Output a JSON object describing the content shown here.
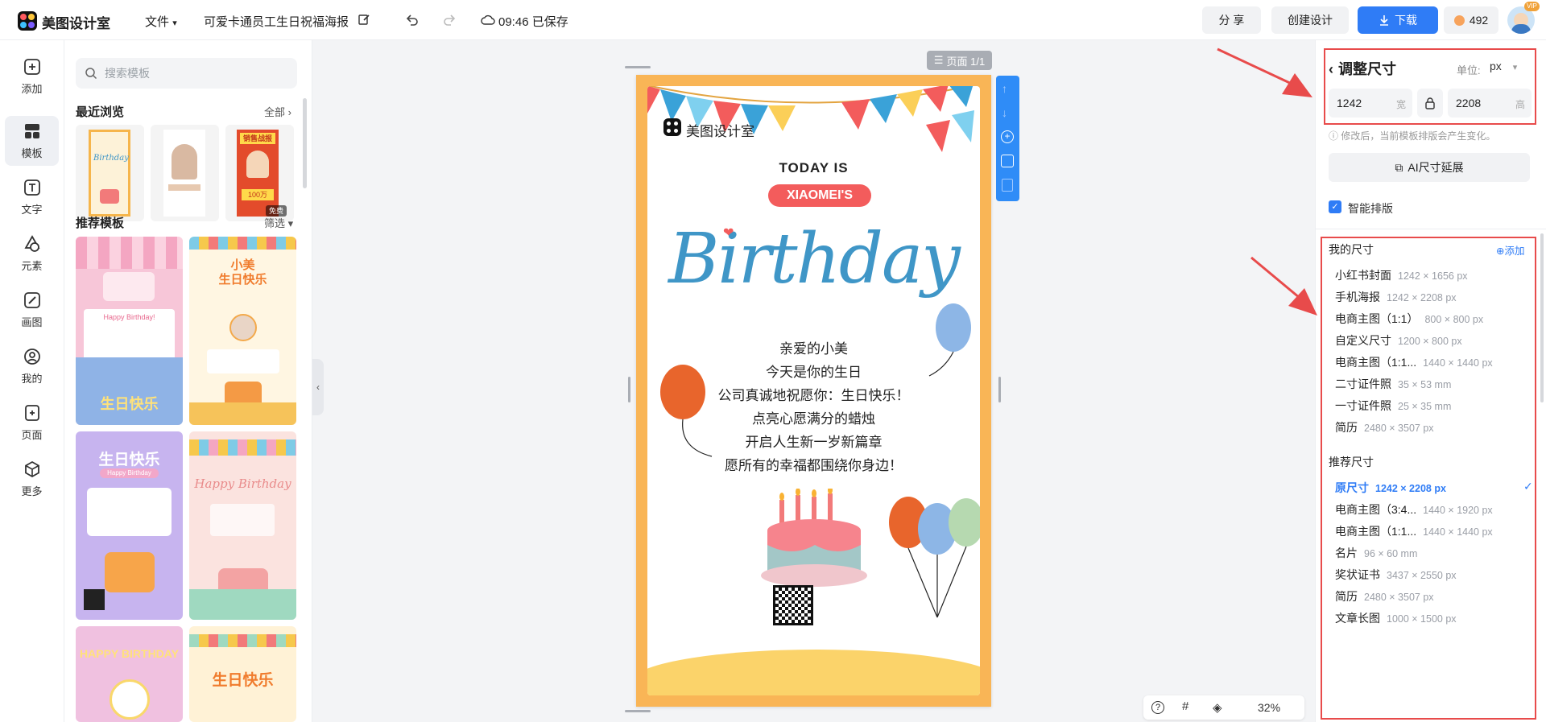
{
  "app": {
    "name": "美图设计室"
  },
  "topbar": {
    "file_menu": "文件",
    "doc_title": "可爱卡通员工生日祝福海报",
    "save_status": "09:46 已保存",
    "share": "分 享",
    "create": "创建设计",
    "download": "下载",
    "coins": "492",
    "vip_badge": "VIP"
  },
  "rail": [
    {
      "label": "添加",
      "icon": "add-icon"
    },
    {
      "label": "模板",
      "icon": "template-icon"
    },
    {
      "label": "文字",
      "icon": "text-icon"
    },
    {
      "label": "元素",
      "icon": "element-icon"
    },
    {
      "label": "画图",
      "icon": "draw-icon"
    },
    {
      "label": "我的",
      "icon": "user-icon"
    },
    {
      "label": "页面",
      "icon": "page-icon"
    },
    {
      "label": "更多",
      "icon": "more-icon"
    }
  ],
  "template_panel": {
    "search_placeholder": "搜索模板",
    "recent_title": "最近浏览",
    "recent_all": "全部",
    "recommend_title": "推荐模板",
    "filter": "筛选",
    "free_badge": "免费",
    "thumbs": {
      "t1_title": "Happy Birthday!",
      "t1_bottom": "生日快乐",
      "t2_title": "小美",
      "t2_sub": "生日快乐",
      "t3_title": "生日快乐",
      "t3_sub": "Happy Birthday",
      "t4_title": "Happy Birthday",
      "t5_title": "HAPPY BIRTHDAY",
      "t6_title": "生日快乐",
      "r3_title": "销售战报",
      "r3_num": "100万"
    }
  },
  "canvas": {
    "page_indicator": "页面 1/1",
    "zoom": "32%"
  },
  "poster": {
    "brand": "美图设计室",
    "today": "TODAY IS",
    "name": "XIAOMEI'S",
    "birthday": "Birthday",
    "lines": [
      "亲爱的小美",
      "今天是你的生日",
      "公司真诚地祝愿你：生日快乐！",
      "点亮心愿满分的蜡烛",
      "开启人生新一岁新篇章",
      "愿所有的幸福都围绕你身边！"
    ]
  },
  "right_panel": {
    "title": "调整尺寸",
    "unit_label": "单位:",
    "unit_value": "px",
    "width_value": "1242",
    "width_suffix": "宽",
    "height_value": "2208",
    "height_suffix": "高",
    "notice": "修改后，当前模板排版会产生变化。",
    "ai_extend": "AI尺寸延展",
    "smart_layout": "智能排版",
    "my_sizes_title": "我的尺寸",
    "add": "添加",
    "my_sizes": [
      {
        "name": "小红书封面",
        "dim": "1242 × 1656 px"
      },
      {
        "name": "手机海报",
        "dim": "1242 × 2208 px"
      },
      {
        "name": "电商主图（1:1）",
        "dim": "800 × 800 px"
      },
      {
        "name": "自定义尺寸",
        "dim": "1200 × 800 px"
      },
      {
        "name": "电商主图（1:1...",
        "dim": "1440 × 1440 px"
      },
      {
        "name": "二寸证件照",
        "dim": "35 × 53 mm"
      },
      {
        "name": "一寸证件照",
        "dim": "25 × 35 mm"
      },
      {
        "name": "简历",
        "dim": "2480 × 3507 px"
      }
    ],
    "rec_sizes_title": "推荐尺寸",
    "rec_sizes": [
      {
        "name": "原尺寸",
        "dim": "1242 × 2208 px",
        "selected": true
      },
      {
        "name": "电商主图（3:4...",
        "dim": "1440 × 1920 px"
      },
      {
        "name": "电商主图（1:1...",
        "dim": "1440 × 1440 px"
      },
      {
        "name": "名片",
        "dim": "96 × 60 mm"
      },
      {
        "name": "奖状证书",
        "dim": "3437 × 2550 px"
      },
      {
        "name": "简历",
        "dim": "2480 × 3507 px"
      },
      {
        "name": "文章长图",
        "dim": "1000 × 1500 px"
      }
    ]
  },
  "colors": {
    "accent": "#2f7cf6",
    "annotation": "#e84b4b",
    "poster_frame": "#f9b556",
    "title_blue": "#3f96c7"
  }
}
